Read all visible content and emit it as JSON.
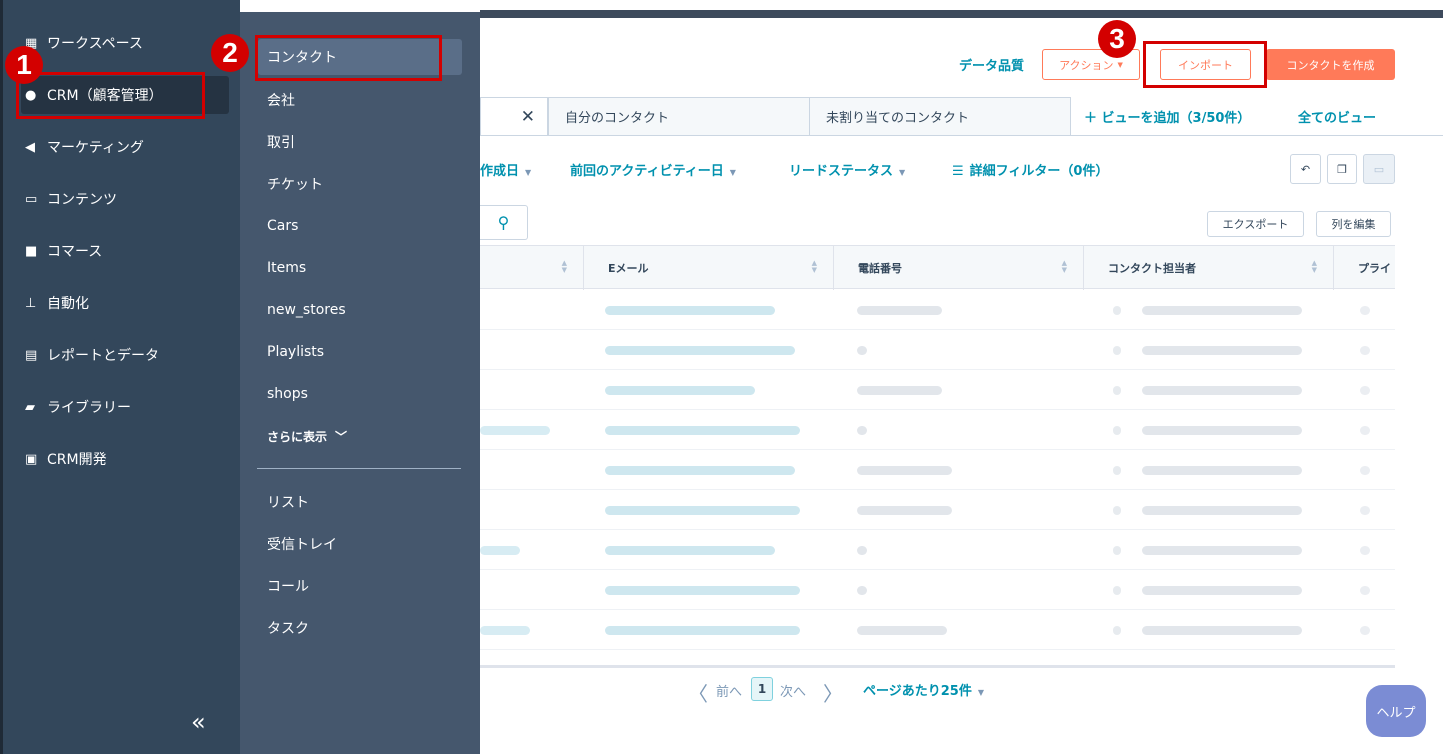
{
  "sidebar": {
    "items": [
      {
        "label": "ワークスペース",
        "icon": "grid-icon"
      },
      {
        "label": "CRM（顧客管理）",
        "icon": "person-icon"
      },
      {
        "label": "マーケティング",
        "icon": "megaphone-icon"
      },
      {
        "label": "コンテンツ",
        "icon": "window-icon"
      },
      {
        "label": "コマース",
        "icon": "wallet-icon"
      },
      {
        "label": "自動化",
        "icon": "workflow-icon"
      },
      {
        "label": "レポートとデータ",
        "icon": "chart-icon"
      },
      {
        "label": "ライブラリー",
        "icon": "folder-icon"
      },
      {
        "label": "CRM開発",
        "icon": "image-icon"
      }
    ],
    "collapse_glyph": "«"
  },
  "submenu": {
    "items": [
      "コンタクト",
      "会社",
      "取引",
      "チケット",
      "Cars",
      "Items",
      "new_stores",
      "Playlists",
      "shops"
    ],
    "more_label": "さらに表示",
    "lower_items": [
      "リスト",
      "受信トレイ",
      "コール",
      "タスク"
    ]
  },
  "header": {
    "data_quality": "データ品質",
    "actions": "アクション",
    "import": "インポート",
    "create_contact": "コンタクトを作成"
  },
  "tabs": {
    "my_contacts": "自分のコンタクト",
    "unassigned": "未割り当てのコンタクト",
    "add_view": "ビューを追加（3/50件）",
    "all_views": "全てのビュー"
  },
  "filters": {
    "create_date": "作成日",
    "last_activity": "前回のアクティビティー日",
    "lead_status": "リードステータス",
    "advanced": "詳細フィルター（0件）"
  },
  "toolbar": {
    "export": "エクスポート",
    "edit_columns": "列を編集"
  },
  "table": {
    "columns": [
      "Eメール",
      "電話番号",
      "コンタクト担当者",
      "プライ"
    ]
  },
  "pagination": {
    "prev": "前へ",
    "page": "1",
    "next": "次へ",
    "per_page": "ページあたり25件"
  },
  "help": "ヘルプ",
  "annotations": [
    "1",
    "2",
    "3"
  ],
  "colors": {
    "sidebar": "#33475b",
    "submenu": "#45576d",
    "accent": "#ff7a59",
    "link": "#0091ae",
    "annotation": "#d30000"
  }
}
